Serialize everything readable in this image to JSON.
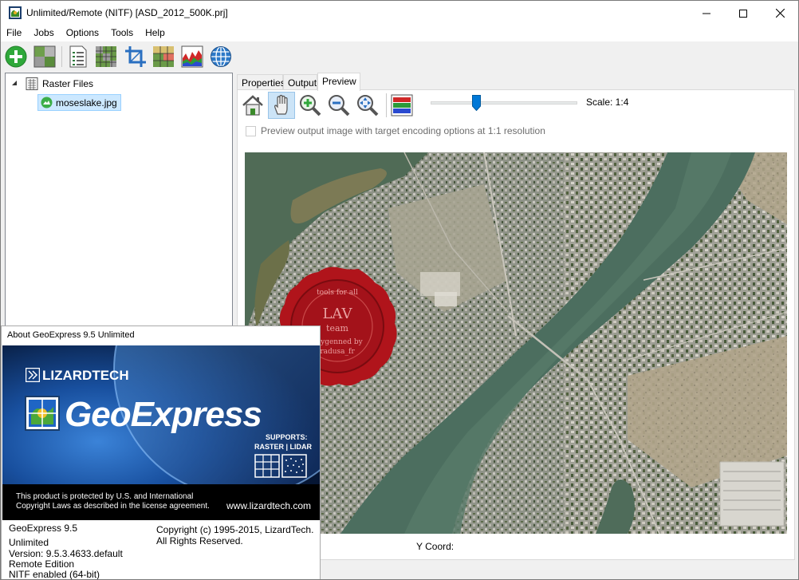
{
  "window": {
    "title": "Unlimited/Remote (NITF) [ASD_2012_500K.prj]"
  },
  "menu": [
    "File",
    "Jobs",
    "Options",
    "Tools",
    "Help"
  ],
  "toolbar": {
    "icons": [
      "add-icon",
      "mosaic-icon",
      "metadata-icon",
      "grid-icon",
      "crop-icon",
      "bands-icon",
      "histogram-icon",
      "globe-icon"
    ]
  },
  "tree": {
    "root_label": "Raster Files",
    "items": [
      {
        "label": "moseslake.jpg"
      }
    ]
  },
  "tabs": [
    {
      "label": "Properties",
      "active": false
    },
    {
      "label": "Output",
      "active": false
    },
    {
      "label": "Preview",
      "active": true
    }
  ],
  "preview": {
    "scale_label": "Scale: 1:4",
    "scale_slider": 0.3,
    "checkbox_label": "Preview output image with target encoding options at 1:1 resolution",
    "checkbox_checked": false,
    "y_coord_label": "Y Coord:"
  },
  "about": {
    "title": "About GeoExpress 9.5 Unlimited",
    "brand": "LIZARDTECH",
    "product": "GeoExpress",
    "supports_line1": "SUPPORTS:",
    "supports_line2": "RASTER | LIDAR",
    "legal_line1": "This product is protected by U.S. and International",
    "legal_line2": "Copyright Laws as described in the license agreement.",
    "website": "www.lizardtech.com",
    "version_name": "GeoExpress 9.5",
    "edition": "Unlimited",
    "version": "Version: 9.5.3.4633.default",
    "remote": "Remote Edition",
    "nitf": "NITF enabled (64-bit)",
    "copyright_line1": "Copyright (c) 1995-2015, LizardTech.",
    "copyright_line2": "All Rights Reserved."
  },
  "seal": {
    "text_main": "LAV",
    "text_team": "team",
    "text_arc": "tools for all",
    "text_line1": "keygenned by",
    "text_line2": "radusa_fr"
  }
}
